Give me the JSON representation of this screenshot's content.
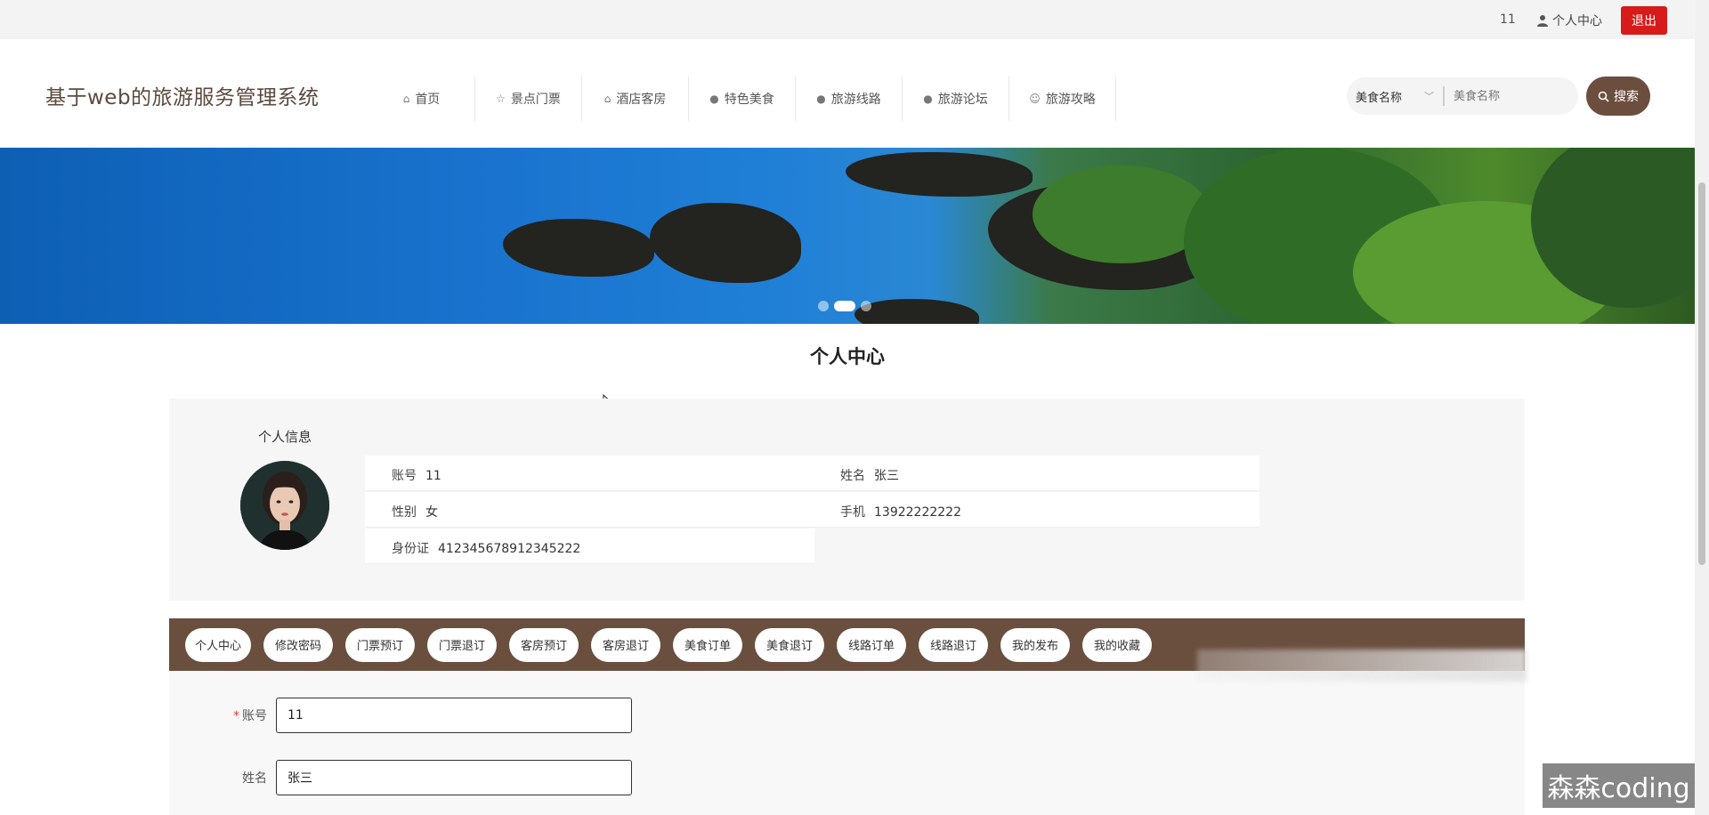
{
  "topbar": {
    "username": "11",
    "user_center": "个人中心",
    "logout": "退出"
  },
  "header": {
    "site_title": "基于web的旅游服务管理系统",
    "nav": [
      {
        "label": "首页",
        "icon": "home-icon"
      },
      {
        "label": "景点门票",
        "icon": "star-icon"
      },
      {
        "label": "酒店客房",
        "icon": "bag-icon"
      },
      {
        "label": "特色美食",
        "icon": "info-icon"
      },
      {
        "label": "旅游线路",
        "icon": "help-icon"
      },
      {
        "label": "旅游论坛",
        "icon": "info-icon"
      },
      {
        "label": "旅游攻略",
        "icon": "smile-icon"
      }
    ],
    "search": {
      "select_value": "美食名称",
      "placeholder": "美食名称",
      "button": "搜索"
    }
  },
  "banner": {
    "slide_count": 3,
    "active_slide": 2
  },
  "main": {
    "page_title": "个人中心",
    "info": {
      "section_title": "个人信息",
      "account_label": "账号",
      "account_value": "11",
      "name_label": "姓名",
      "name_value": "张三",
      "gender_label": "性别",
      "gender_value": "女",
      "phone_label": "手机",
      "phone_value": "13922222222",
      "idcard_label": "身份证",
      "idcard_value": "412345678912345222"
    },
    "tabs": [
      "个人中心",
      "修改密码",
      "门票预订",
      "门票退订",
      "客房预订",
      "客房退订",
      "美食订单",
      "美食退订",
      "线路订单",
      "线路退订",
      "我的发布",
      "我的收藏"
    ],
    "form": {
      "account_label": "账号",
      "account_value": "11",
      "name_label": "姓名",
      "name_value": "张三"
    }
  },
  "watermark": "森森coding",
  "colors": {
    "brand": "#6a4f3f",
    "logout": "#d71a1a"
  }
}
